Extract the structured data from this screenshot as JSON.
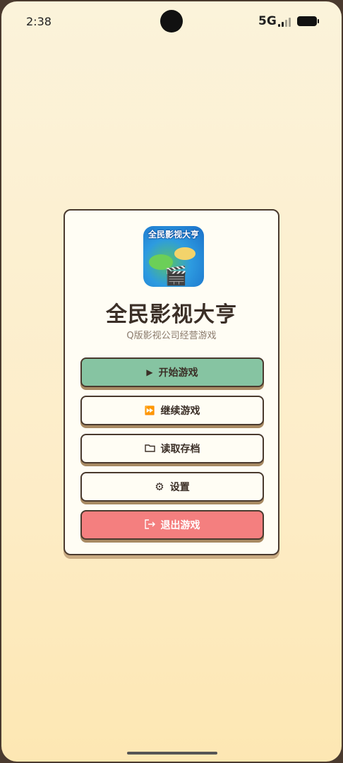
{
  "status_bar": {
    "time": "2:38",
    "network": "5G"
  },
  "logo": {
    "title": "全民影视大亨",
    "icon": "clapperboard-icon"
  },
  "app": {
    "title": "全民影视大亨",
    "subtitle": "Q版影视公司经营游戏"
  },
  "menu": {
    "start": {
      "label": "开始游戏",
      "icon": "play-icon"
    },
    "continue": {
      "label": "继续游戏",
      "icon": "fast-forward-icon"
    },
    "load": {
      "label": "读取存档",
      "icon": "folder-icon"
    },
    "settings": {
      "label": "设置",
      "icon": "gear-icon"
    },
    "exit": {
      "label": "退出游戏",
      "icon": "exit-icon"
    }
  },
  "colors": {
    "start_button": "#86c4a2",
    "exit_button": "#f47f7f",
    "card_background": "#fffdf4",
    "border": "#4a3a2e",
    "text": "#3b2f27"
  }
}
